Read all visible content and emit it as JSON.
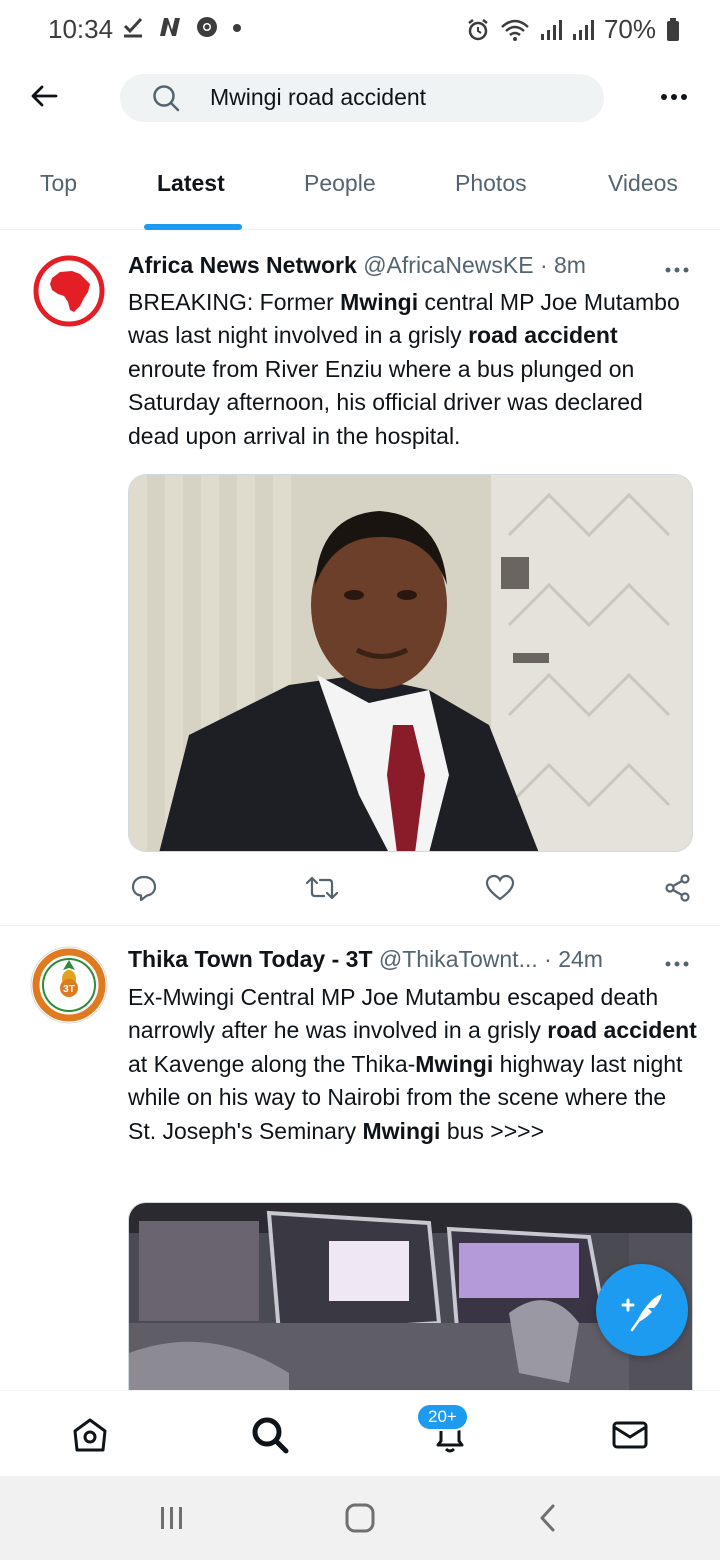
{
  "status_bar": {
    "time": "10:34",
    "battery": "70%",
    "icons": [
      "check-icon",
      "n-icon",
      "chrome-icon",
      "dot-icon",
      "alarm-icon",
      "wifi-icon",
      "signal-icon",
      "signal-icon",
      "battery-icon"
    ]
  },
  "search": {
    "query": "Mwingi road accident"
  },
  "tabs": [
    {
      "label": "Top",
      "active": false
    },
    {
      "label": "Latest",
      "active": true
    },
    {
      "label": "People",
      "active": false
    },
    {
      "label": "Photos",
      "active": false
    },
    {
      "label": "Videos",
      "active": false
    }
  ],
  "tweets": [
    {
      "name": "Africa News Network",
      "handle": "@AfricaNewsKE",
      "separator": "·",
      "time": "8m",
      "segments": [
        {
          "text": "BREAKING: Former ",
          "bold": false
        },
        {
          "text": "Mwingi",
          "bold": true
        },
        {
          "text": " central MP Joe Mutambo was last night involved in a grisly ",
          "bold": false
        },
        {
          "text": "road accident",
          "bold": true
        },
        {
          "text": " enroute from River Enziu where a bus plunged on Saturday afternoon, his official driver was declared dead upon arrival in the hospital.",
          "bold": false
        }
      ],
      "avatar_color": "#e31e24"
    },
    {
      "name": "Thika Town Today - 3T",
      "handle": "@ThikaTownt...",
      "separator": "·",
      "time": "24m",
      "segments": [
        {
          "text": "Ex-Mwingi Central MP Joe Mutambu escaped death narrowly after he was involved in a grisly ",
          "bold": false
        },
        {
          "text": "road accident",
          "bold": true
        },
        {
          "text": " at Kavenge along the Thika-",
          "bold": false
        },
        {
          "text": "Mwingi",
          "bold": true
        },
        {
          "text": " highway last night while on his way to Nairobi from the scene where the St. Joseph's Seminary ",
          "bold": false
        },
        {
          "text": "Mwingi",
          "bold": true
        },
        {
          "text": " bus >>>>",
          "bold": false
        }
      ],
      "avatar_color": "#e07a1f"
    }
  ],
  "bottom_nav": {
    "notification_badge": "20+"
  },
  "colors": {
    "accent": "#1d9bf0",
    "text_primary": "#0f1419",
    "text_secondary": "#536471"
  }
}
